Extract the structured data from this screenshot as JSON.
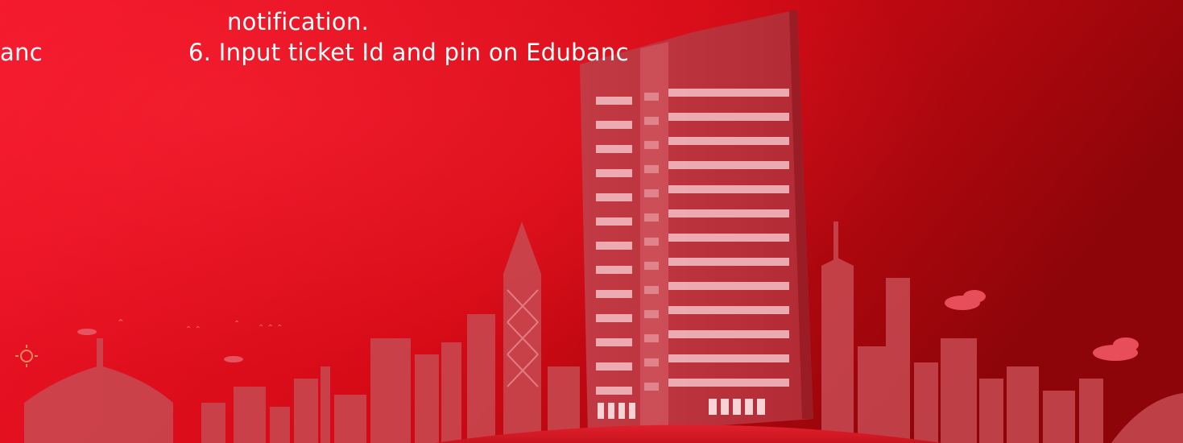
{
  "slide": {
    "lines": {
      "notification": "notification.",
      "left_fragment": "anc",
      "step6": "6. Input ticket Id and pin on Edubanc"
    }
  },
  "colors": {
    "background_light": "#f2162b",
    "background_dark": "#8e0509",
    "skyline": "#c84a52",
    "tower_window": "#f1b8bd",
    "text": "#ffffff"
  }
}
